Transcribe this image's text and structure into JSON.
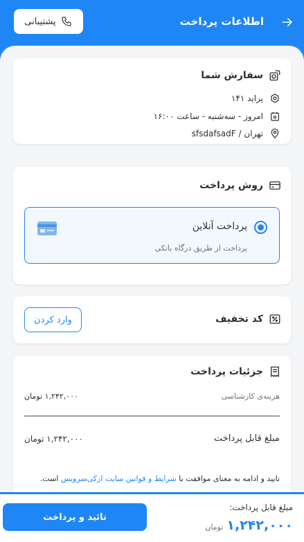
{
  "header": {
    "title": "اطلاعات پرداخت",
    "support_label": "پشتیبانی"
  },
  "order": {
    "title": "سفارش شما",
    "items": [
      {
        "icon": "gear-icon",
        "text": "پراید ۱۴۱"
      },
      {
        "icon": "calendar-icon",
        "text": "امروز - سه‌شنبه - ساعت ۱۶:۰۰"
      },
      {
        "icon": "location-pin-icon",
        "text": "تهران / sfsdafsadF"
      }
    ]
  },
  "payment_method": {
    "title": "روش پرداخت",
    "option_name": "پرداخت آنلاین",
    "option_desc": "پرداخت از طریق درگاه بانکی",
    "selected": true
  },
  "discount": {
    "title": "کد تخفیف",
    "button_label": "وارد کردن"
  },
  "details": {
    "title": "جزئیات پرداخت",
    "fee_label": "هزینه‌ی کارشناسی",
    "fee_value": "۱,۲۴۲,۰۰۰ تومان",
    "payable_label": "مبلغ قابل پرداخت",
    "payable_value": "۱,۲۴۲,۰۰۰ تومان",
    "terms_prefix": "تایید و ادامه به معنای موافقت با",
    "terms_link": "شرایط و قوانین سایت ازکی‌سرویس",
    "terms_suffix": "است."
  },
  "footer": {
    "total_label": "مبلغ قابل پرداخت:",
    "total_value": "۱,۲۴۲,۰۰۰",
    "total_unit": "تومان",
    "confirm_label": "تائید و پرداخت"
  },
  "colors": {
    "accent": "#1f86f5",
    "background": "#f4f5f7"
  }
}
